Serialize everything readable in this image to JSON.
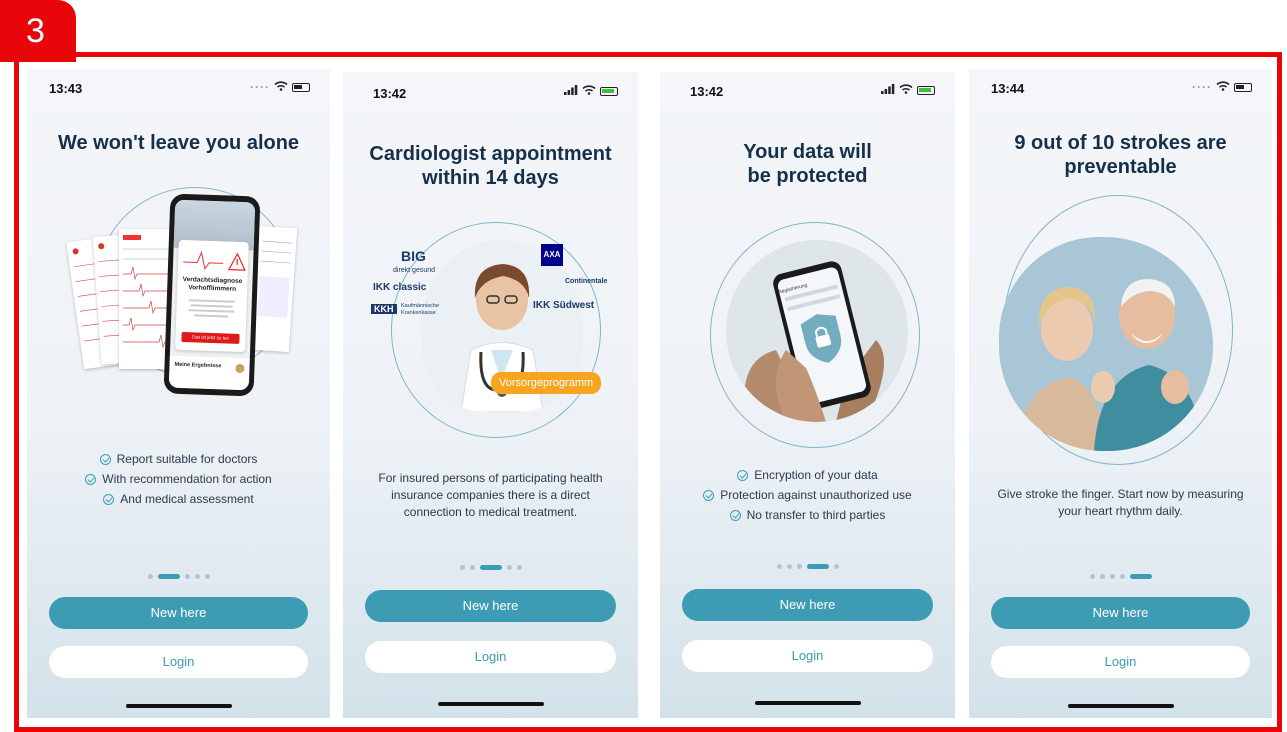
{
  "step_badge": "3",
  "screens": [
    {
      "time": "13:43",
      "title": "We won't leave you alone",
      "card": {
        "heading": "Verdachtsdiagnose Vorhofflimmern",
        "button": "Das ist jetzt zu tun",
        "results": "Meine Ergebnisse"
      },
      "features": [
        "Report suitable for doctors",
        "With recommendation for action",
        "And medical assessment"
      ],
      "active_dot": 1,
      "new_here": "New here",
      "login": "Login"
    },
    {
      "time": "13:42",
      "title_line1": "Cardiologist appointment",
      "title_line2": "within 14 days",
      "logos": [
        "BIG",
        "direkt gesund",
        "IKK classic",
        "KKH",
        "Kaufmännische Krankenkasse",
        "AXA",
        "Continentale",
        "IKK Südwest"
      ],
      "tag": "Vorsorgeprogramm",
      "paragraph": "For insured persons of participating health insurance companies there is a direct connection to medical treatment.",
      "active_dot": 2,
      "new_here": "New here",
      "login": "Login"
    },
    {
      "time": "13:42",
      "title_line1": "Your data will",
      "title_line2": "be protected",
      "phone_label": "Registrierung",
      "features": [
        "Encryption of your data",
        "Protection against unauthorized use",
        "No transfer to third parties"
      ],
      "active_dot": 3,
      "new_here": "New here",
      "login": "Login"
    },
    {
      "time": "13:44",
      "title_line1": "9 out of 10 strokes are",
      "title_line2": "preventable",
      "paragraph": "Give stroke the finger. Start now by measuring your heart rhythm daily.",
      "active_dot": 4,
      "new_here": "New here",
      "login": "Login"
    }
  ],
  "colors": {
    "frame": "#e8060b",
    "accent": "#3d9cb3",
    "title": "#17304a",
    "tag": "#f7a521"
  }
}
